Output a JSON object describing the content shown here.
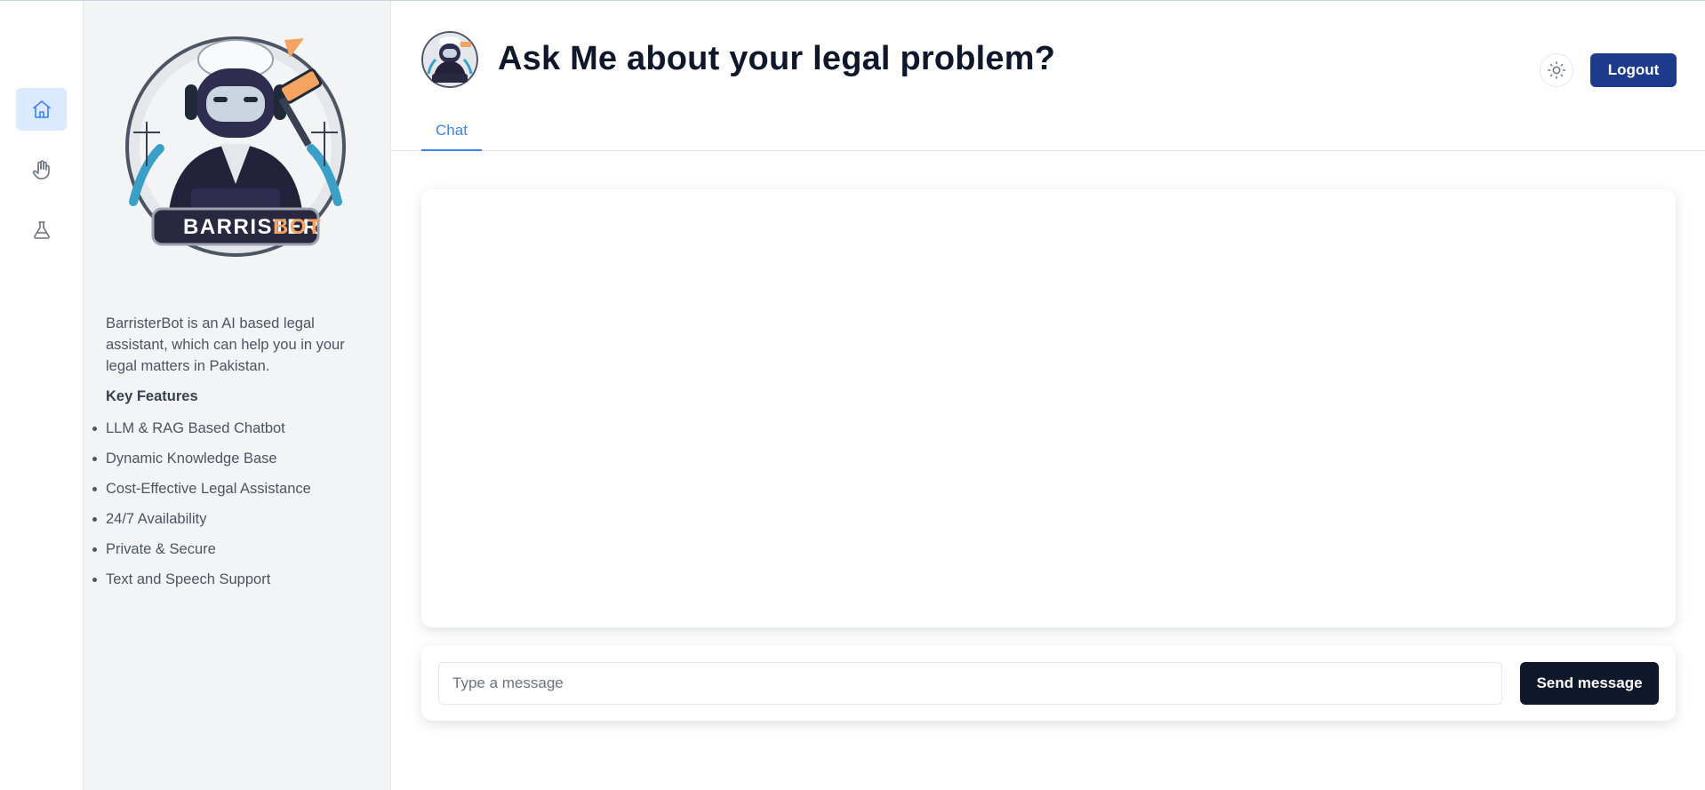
{
  "rail": {
    "items": [
      {
        "icon": "home-icon",
        "active": true
      },
      {
        "icon": "hand-icon",
        "active": false
      },
      {
        "icon": "flask-icon",
        "active": false
      }
    ]
  },
  "sidebar": {
    "logo_text_main": "BARRISTER",
    "logo_text_accent": "BOT",
    "description": "BarristerBot is an AI based legal assistant, which can help you in your legal matters in Pakistan.",
    "features_title": "Key Features",
    "features": [
      "LLM & RAG Based Chatbot",
      "Dynamic Knowledge Base",
      "Cost-Effective Legal Assistance",
      "24/7 Availability",
      "Private & Secure",
      "Text and Speech Support"
    ]
  },
  "header": {
    "title": "Ask Me about your legal problem?",
    "logout_label": "Logout",
    "theme_icon": "sun-icon"
  },
  "tabs": [
    {
      "label": "Chat",
      "active": true
    }
  ],
  "composer": {
    "placeholder": "Type a message",
    "value": "",
    "send_label": "Send message"
  },
  "colors": {
    "accent": "#3b82f6",
    "logout_bg": "#1e3a8a",
    "send_bg": "#0f172a",
    "logo_accent": "#f4a460"
  }
}
